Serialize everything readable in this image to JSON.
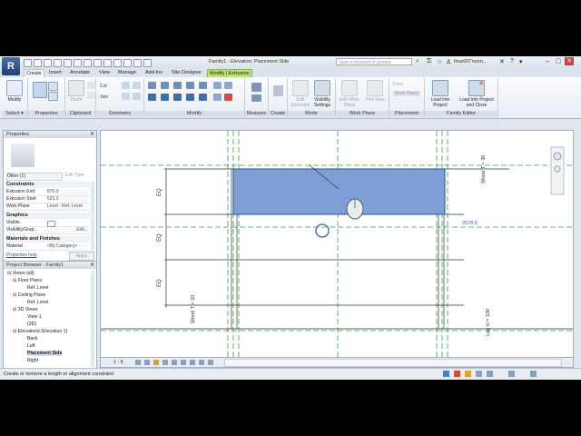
{
  "app": {
    "logo_letter": "R",
    "document_title": "Family1 - Elevation: Placement Side",
    "search_placeholder": "Type a keyword or phrase",
    "user": "firas007noon...",
    "window_controls": [
      "–",
      "▢",
      "✕"
    ]
  },
  "tabs": [
    {
      "label": "Create"
    },
    {
      "label": "Insert"
    },
    {
      "label": "Annotate"
    },
    {
      "label": "View"
    },
    {
      "label": "Manage"
    },
    {
      "label": "Add-Ins"
    },
    {
      "label": "Site Designer"
    },
    {
      "label": "Modify | Extrusion"
    }
  ],
  "ribbon": {
    "panels": {
      "select": "Select ▾",
      "properties": "Properties",
      "clipboard": "Clipboard",
      "geometry": "Geometry",
      "modify": "Modify",
      "measure": "Measure",
      "create": "Create",
      "mode": "Mode",
      "work_plane": "Work Plane",
      "placement": "Placement",
      "family_editor": "Family Editor"
    },
    "buttons": {
      "modify": "Modify",
      "paste": "Paste",
      "cut": "Cut",
      "join": "Join",
      "edit_extrusion": "Edit Extrusion",
      "visibility_settings": "Visibility Settings",
      "edit_work_plane": "Edit Work Plane",
      "pick_new": "Pick New",
      "face": "Face",
      "work_plane_placement": "Work Plane",
      "load_into_project": "Load into Project",
      "load_into_project_and_close": "Load into Project and Close"
    }
  },
  "properties": {
    "title": "Properties",
    "type_selector": "Other (1)",
    "edit_type": "Edit Type",
    "sections": {
      "constraints": "Constraints",
      "graphics": "Graphics",
      "materials": "Materials and Finishes"
    },
    "rows": [
      {
        "key": "Extrusion End",
        "value": "870.0"
      },
      {
        "key": "Extrusion Start",
        "value": "623.3"
      },
      {
        "key": "Work Plane",
        "value": "Level : Ref. Level"
      },
      {
        "key": "Visible",
        "value": ""
      },
      {
        "key": "Visibility/Grap...",
        "value": "Edit..."
      },
      {
        "key": "Material",
        "value": "<By Category>"
      }
    ],
    "help_link": "Properties help",
    "apply": "Apply"
  },
  "browser": {
    "title": "Project Browser - Family1",
    "items": [
      {
        "label": "Views (all)"
      },
      {
        "label": "Floor Plans"
      },
      {
        "label": "Ref. Level"
      },
      {
        "label": "Ceiling Plans"
      },
      {
        "label": "Ref. Level"
      },
      {
        "label": "3D Views"
      },
      {
        "label": "View 1"
      },
      {
        "label": "{3D}"
      },
      {
        "label": "Elevations (Elevation 1)"
      },
      {
        "label": "Back"
      },
      {
        "label": "Left"
      },
      {
        "label": "Placement Side"
      },
      {
        "label": "Right"
      }
    ]
  },
  "canvas": {
    "eq_labels": [
      "EQ",
      "EQ",
      "EQ"
    ],
    "dim_top_right": "Wood T = 30",
    "dim_left_bottom": "Wood T = 10",
    "dim_right_bottom": "Leg H = 100",
    "dim_value": "2578.0",
    "extrusion_color": "#7e9fd6"
  },
  "view_control": {
    "scale": "1 : 5"
  },
  "status": {
    "text": "Create or remove a length or alignment constraint"
  }
}
